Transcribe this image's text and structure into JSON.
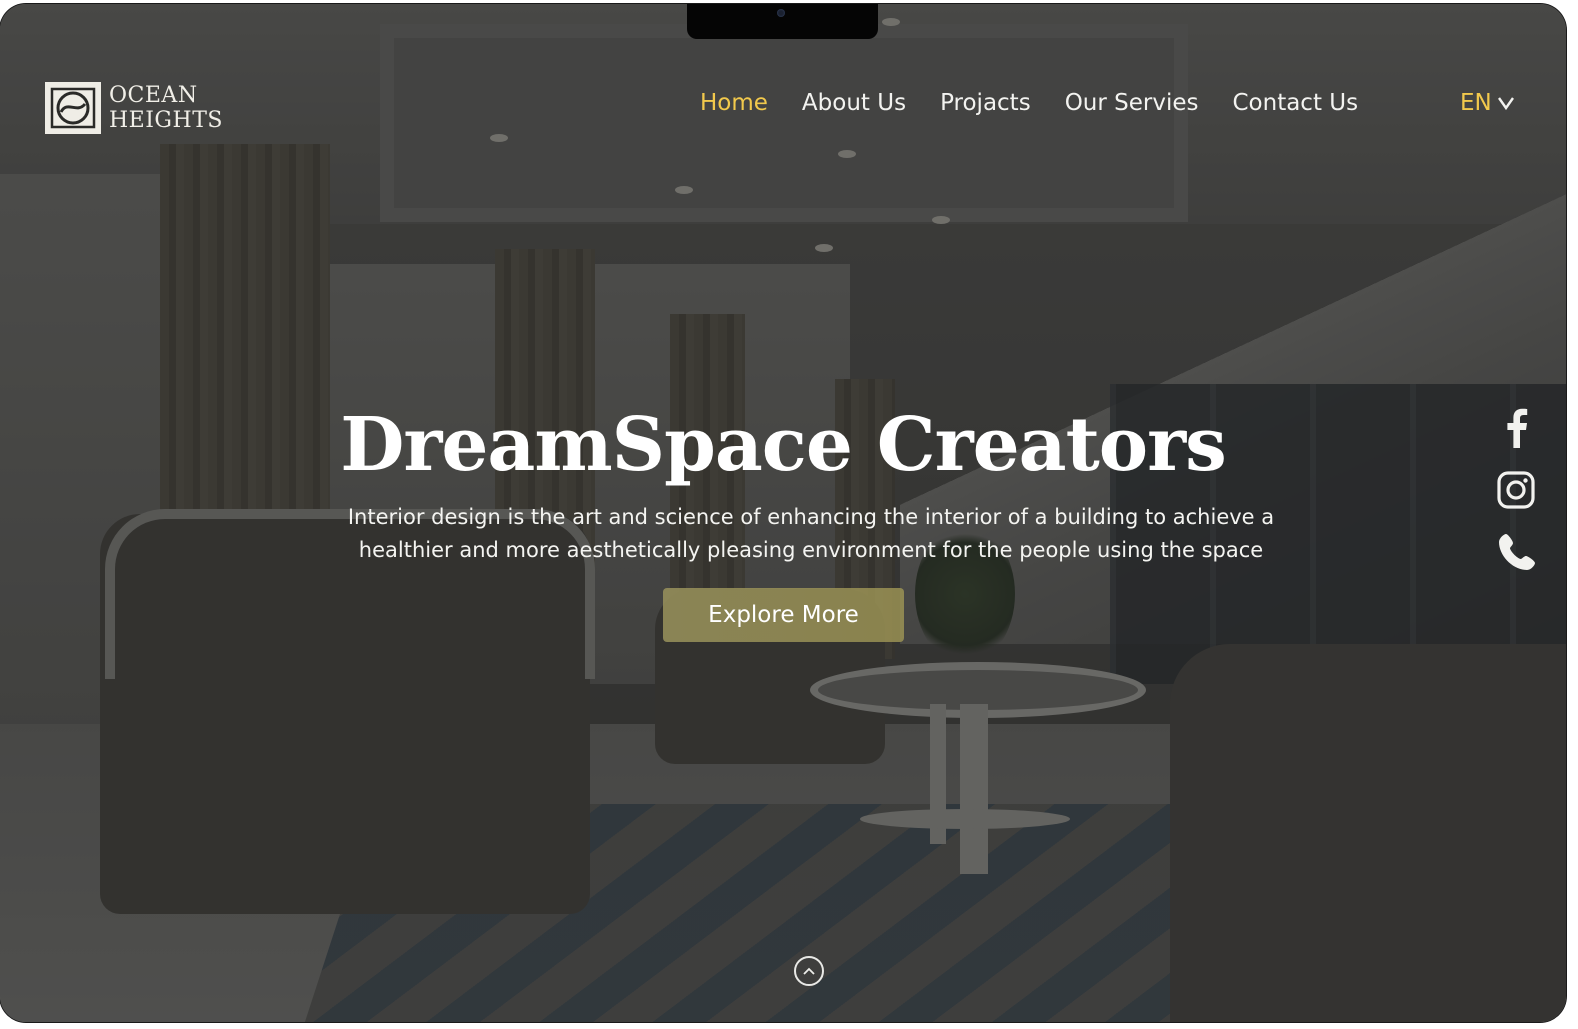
{
  "brand": {
    "line1": "OCEAN",
    "line2": "HEIGHTS",
    "logo_icon": "ocean-heights-monogram"
  },
  "nav": {
    "items": [
      {
        "label": "Home",
        "active": true
      },
      {
        "label": "About Us",
        "active": false
      },
      {
        "label": "Projacts",
        "active": false
      },
      {
        "label": "Our Servies",
        "active": false
      },
      {
        "label": "Contact Us",
        "active": false
      }
    ],
    "active_color": "#f2c94c"
  },
  "language": {
    "selected": "EN",
    "icon": "chevron-down-icon"
  },
  "hero": {
    "title": "DreamSpace Creators",
    "description_line1": "Interior design is the art and science of enhancing the interior of a building to achieve a",
    "description_line2": "healthier and more aesthetically pleasing environment for the people using the space",
    "cta_label": "Explore More"
  },
  "social": [
    {
      "icon": "facebook-icon"
    },
    {
      "icon": "instagram-icon"
    },
    {
      "icon": "phone-icon"
    }
  ],
  "scroll": {
    "icon": "chevron-up-icon"
  },
  "colors": {
    "accent": "#f2c94c",
    "button": "#9a935d",
    "text": "#ffffff"
  }
}
